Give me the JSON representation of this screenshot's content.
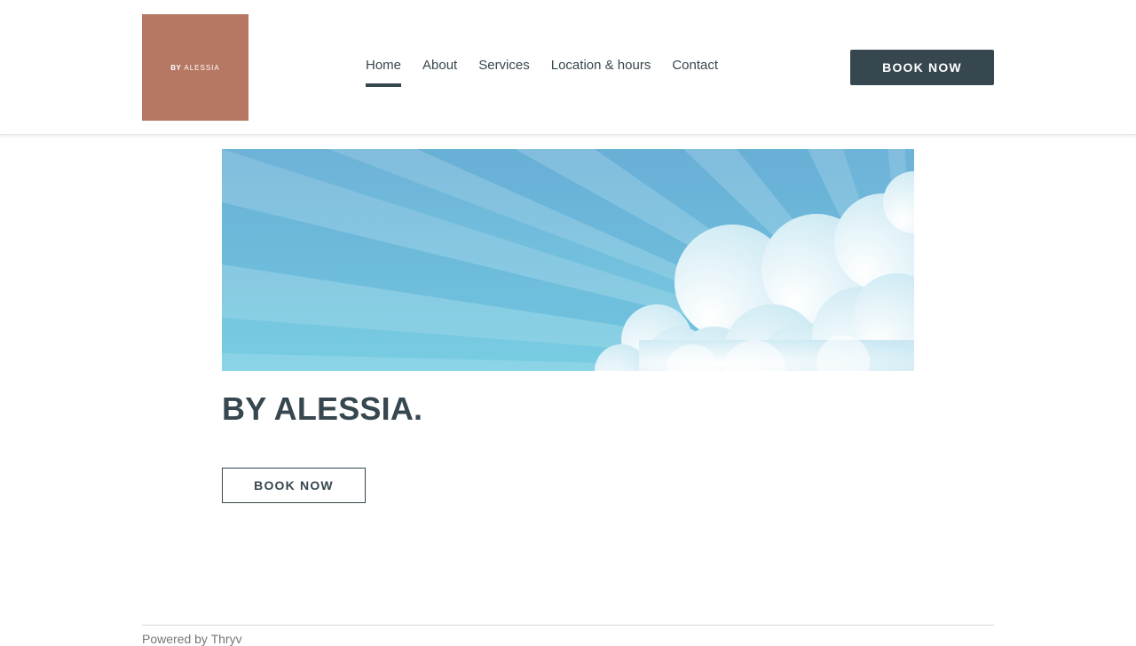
{
  "header": {
    "logo": {
      "bold_text": "BY",
      "light_text": "ALESSIA",
      "color": "#b77863"
    },
    "nav": [
      {
        "label": "Home",
        "active": true
      },
      {
        "label": "About",
        "active": false
      },
      {
        "label": "Services",
        "active": false
      },
      {
        "label": "Location & hours",
        "active": false
      },
      {
        "label": "Contact",
        "active": false
      }
    ],
    "book_label": "BOOK NOW"
  },
  "main": {
    "hero": {
      "description": "blue sky with sun rays and clouds"
    },
    "title": "BY ALESSIA.",
    "book_label": "BOOK NOW"
  },
  "footer": {
    "text": "Powered by Thryv"
  },
  "colors": {
    "text_dark": "#37474f",
    "logo_bg": "#b77863",
    "sky_light": "#7fd0e2",
    "sky_dark": "#5fa9d6"
  }
}
